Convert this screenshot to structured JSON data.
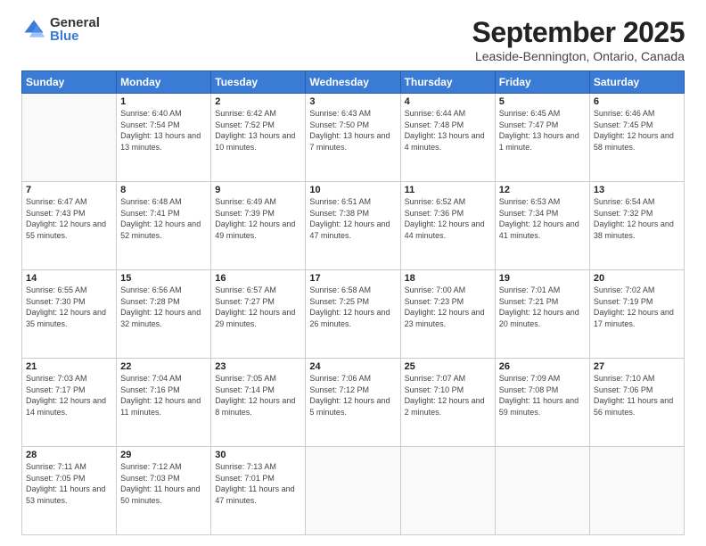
{
  "logo": {
    "general": "General",
    "blue": "Blue"
  },
  "title": "September 2025",
  "subtitle": "Leaside-Bennington, Ontario, Canada",
  "days_of_week": [
    "Sunday",
    "Monday",
    "Tuesday",
    "Wednesday",
    "Thursday",
    "Friday",
    "Saturday"
  ],
  "weeks": [
    [
      null,
      {
        "day": 1,
        "sunrise": "6:40 AM",
        "sunset": "7:54 PM",
        "daylight": "13 hours and 13 minutes."
      },
      {
        "day": 2,
        "sunrise": "6:42 AM",
        "sunset": "7:52 PM",
        "daylight": "13 hours and 10 minutes."
      },
      {
        "day": 3,
        "sunrise": "6:43 AM",
        "sunset": "7:50 PM",
        "daylight": "13 hours and 7 minutes."
      },
      {
        "day": 4,
        "sunrise": "6:44 AM",
        "sunset": "7:48 PM",
        "daylight": "13 hours and 4 minutes."
      },
      {
        "day": 5,
        "sunrise": "6:45 AM",
        "sunset": "7:47 PM",
        "daylight": "13 hours and 1 minute."
      },
      {
        "day": 6,
        "sunrise": "6:46 AM",
        "sunset": "7:45 PM",
        "daylight": "12 hours and 58 minutes."
      }
    ],
    [
      {
        "day": 7,
        "sunrise": "6:47 AM",
        "sunset": "7:43 PM",
        "daylight": "12 hours and 55 minutes."
      },
      {
        "day": 8,
        "sunrise": "6:48 AM",
        "sunset": "7:41 PM",
        "daylight": "12 hours and 52 minutes."
      },
      {
        "day": 9,
        "sunrise": "6:49 AM",
        "sunset": "7:39 PM",
        "daylight": "12 hours and 49 minutes."
      },
      {
        "day": 10,
        "sunrise": "6:51 AM",
        "sunset": "7:38 PM",
        "daylight": "12 hours and 47 minutes."
      },
      {
        "day": 11,
        "sunrise": "6:52 AM",
        "sunset": "7:36 PM",
        "daylight": "12 hours and 44 minutes."
      },
      {
        "day": 12,
        "sunrise": "6:53 AM",
        "sunset": "7:34 PM",
        "daylight": "12 hours and 41 minutes."
      },
      {
        "day": 13,
        "sunrise": "6:54 AM",
        "sunset": "7:32 PM",
        "daylight": "12 hours and 38 minutes."
      }
    ],
    [
      {
        "day": 14,
        "sunrise": "6:55 AM",
        "sunset": "7:30 PM",
        "daylight": "12 hours and 35 minutes."
      },
      {
        "day": 15,
        "sunrise": "6:56 AM",
        "sunset": "7:28 PM",
        "daylight": "12 hours and 32 minutes."
      },
      {
        "day": 16,
        "sunrise": "6:57 AM",
        "sunset": "7:27 PM",
        "daylight": "12 hours and 29 minutes."
      },
      {
        "day": 17,
        "sunrise": "6:58 AM",
        "sunset": "7:25 PM",
        "daylight": "12 hours and 26 minutes."
      },
      {
        "day": 18,
        "sunrise": "7:00 AM",
        "sunset": "7:23 PM",
        "daylight": "12 hours and 23 minutes."
      },
      {
        "day": 19,
        "sunrise": "7:01 AM",
        "sunset": "7:21 PM",
        "daylight": "12 hours and 20 minutes."
      },
      {
        "day": 20,
        "sunrise": "7:02 AM",
        "sunset": "7:19 PM",
        "daylight": "12 hours and 17 minutes."
      }
    ],
    [
      {
        "day": 21,
        "sunrise": "7:03 AM",
        "sunset": "7:17 PM",
        "daylight": "12 hours and 14 minutes."
      },
      {
        "day": 22,
        "sunrise": "7:04 AM",
        "sunset": "7:16 PM",
        "daylight": "12 hours and 11 minutes."
      },
      {
        "day": 23,
        "sunrise": "7:05 AM",
        "sunset": "7:14 PM",
        "daylight": "12 hours and 8 minutes."
      },
      {
        "day": 24,
        "sunrise": "7:06 AM",
        "sunset": "7:12 PM",
        "daylight": "12 hours and 5 minutes."
      },
      {
        "day": 25,
        "sunrise": "7:07 AM",
        "sunset": "7:10 PM",
        "daylight": "12 hours and 2 minutes."
      },
      {
        "day": 26,
        "sunrise": "7:09 AM",
        "sunset": "7:08 PM",
        "daylight": "11 hours and 59 minutes."
      },
      {
        "day": 27,
        "sunrise": "7:10 AM",
        "sunset": "7:06 PM",
        "daylight": "11 hours and 56 minutes."
      }
    ],
    [
      {
        "day": 28,
        "sunrise": "7:11 AM",
        "sunset": "7:05 PM",
        "daylight": "11 hours and 53 minutes."
      },
      {
        "day": 29,
        "sunrise": "7:12 AM",
        "sunset": "7:03 PM",
        "daylight": "11 hours and 50 minutes."
      },
      {
        "day": 30,
        "sunrise": "7:13 AM",
        "sunset": "7:01 PM",
        "daylight": "11 hours and 47 minutes."
      },
      null,
      null,
      null,
      null
    ]
  ]
}
